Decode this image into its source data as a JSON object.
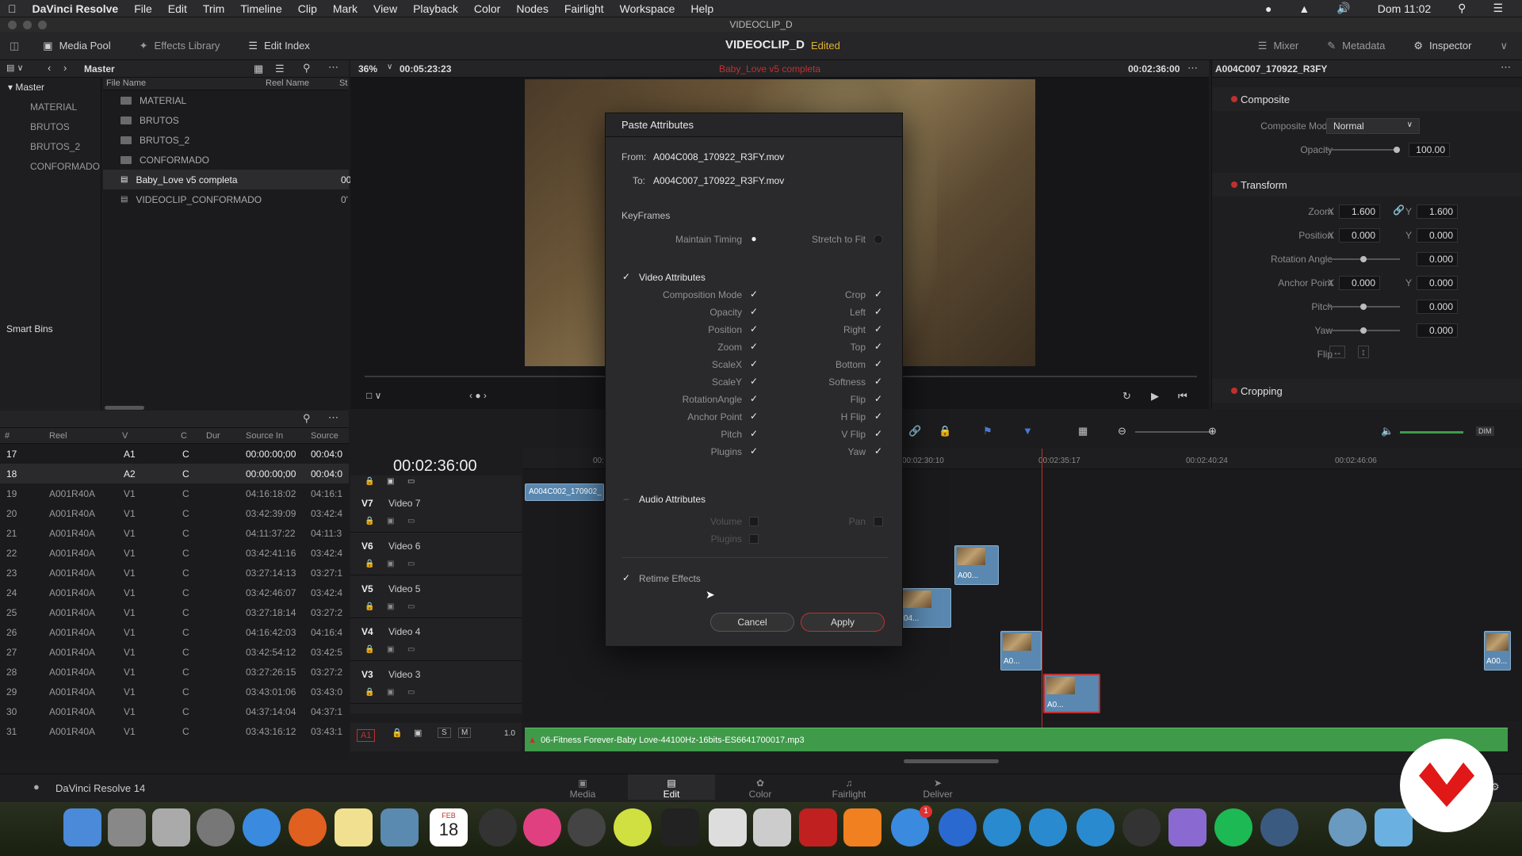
{
  "menubar": {
    "app_name": "DaVinci Resolve",
    "items": [
      "File",
      "Edit",
      "Trim",
      "Timeline",
      "Clip",
      "Mark",
      "View",
      "Playback",
      "Color",
      "Nodes",
      "Fairlight",
      "Workspace",
      "Help"
    ],
    "clock": "Dom 11:02"
  },
  "window": {
    "title": "VIDEOCLIP_D"
  },
  "toolbar": {
    "media_pool": "Media Pool",
    "effects_library": "Effects Library",
    "edit_index": "Edit Index",
    "project_title": "VIDEOCLIP_D",
    "project_status": "Edited",
    "mixer": "Mixer",
    "metadata": "Metadata",
    "inspector": "Inspector"
  },
  "media_pool": {
    "bin_header": "Master",
    "tree_master": "Master",
    "bins": [
      "MATERIAL",
      "BRUTOS",
      "BRUTOS_2",
      "CONFORMADO"
    ],
    "smart_bins": "Smart Bins",
    "columns": {
      "file_name": "File Name",
      "reel_name": "Reel Name",
      "st": "St"
    },
    "files": [
      {
        "name": "MATERIAL",
        "extra": ""
      },
      {
        "name": "BRUTOS",
        "extra": ""
      },
      {
        "name": "BRUTOS_2",
        "extra": ""
      },
      {
        "name": "CONFORMADO",
        "extra": ""
      },
      {
        "name": "Baby_Love v5 completa",
        "extra": "00"
      },
      {
        "name": "VIDEOCLIP_CONFORMADO",
        "extra": "0'"
      }
    ]
  },
  "viewer": {
    "zoom": "36%",
    "source_tc": "00:05:23:23",
    "timeline_name": "Baby_Love v5 completa",
    "record_tc": "00:02:36:00"
  },
  "inspector": {
    "clip_name": "A004C007_170922_R3FY",
    "composite": "Composite",
    "composite_mode_label": "Composite Mode",
    "composite_mode_value": "Normal",
    "opacity_label": "Opacity",
    "opacity_value": "100.00",
    "opacity_level": 1.0,
    "transform": "Transform",
    "zoom_label": "Zoom",
    "zoom_x": "1.600",
    "zoom_y": "1.600",
    "position_label": "Position",
    "position_x": "0.000",
    "position_y": "0.000",
    "rotation_label": "Rotation Angle",
    "rotation_value": "0.000",
    "anchor_label": "Anchor Point",
    "anchor_x": "0.000",
    "anchor_y": "0.000",
    "pitch_label": "Pitch",
    "pitch_value": "0.000",
    "yaw_label": "Yaw",
    "yaw_value": "0.000",
    "flip_label": "Flip",
    "cropping": "Cropping",
    "x": "X",
    "y": "Y"
  },
  "edit_index": {
    "columns": [
      "#",
      "Reel",
      "V",
      "C",
      "Dur",
      "Source In",
      "Source"
    ],
    "rows": [
      {
        "n": "17",
        "reel": "",
        "v": "A1",
        "c": "C",
        "src_in": "00:00:00;00",
        "src": "00:04:0"
      },
      {
        "n": "18",
        "reel": "",
        "v": "A2",
        "c": "C",
        "src_in": "00:00:00;00",
        "src": "00:04:0"
      },
      {
        "n": "19",
        "reel": "A001R40A",
        "v": "V1",
        "c": "C",
        "src_in": "04:16:18:02",
        "src": "04:16:1"
      },
      {
        "n": "20",
        "reel": "A001R40A",
        "v": "V1",
        "c": "C",
        "src_in": "03:42:39:09",
        "src": "03:42:4"
      },
      {
        "n": "21",
        "reel": "A001R40A",
        "v": "V1",
        "c": "C",
        "src_in": "04:11:37:22",
        "src": "04:11:3"
      },
      {
        "n": "22",
        "reel": "A001R40A",
        "v": "V1",
        "c": "C",
        "src_in": "03:42:41:16",
        "src": "03:42:4"
      },
      {
        "n": "23",
        "reel": "A001R40A",
        "v": "V1",
        "c": "C",
        "src_in": "03:27:14:13",
        "src": "03:27:1"
      },
      {
        "n": "24",
        "reel": "A001R40A",
        "v": "V1",
        "c": "C",
        "src_in": "03:42:46:07",
        "src": "03:42:4"
      },
      {
        "n": "25",
        "reel": "A001R40A",
        "v": "V1",
        "c": "C",
        "src_in": "03:27:18:14",
        "src": "03:27:2"
      },
      {
        "n": "26",
        "reel": "A001R40A",
        "v": "V1",
        "c": "C",
        "src_in": "04:16:42:03",
        "src": "04:16:4"
      },
      {
        "n": "27",
        "reel": "A001R40A",
        "v": "V1",
        "c": "C",
        "src_in": "03:42:54:12",
        "src": "03:42:5"
      },
      {
        "n": "28",
        "reel": "A001R40A",
        "v": "V1",
        "c": "C",
        "src_in": "03:27:26:15",
        "src": "03:27:2"
      },
      {
        "n": "29",
        "reel": "A001R40A",
        "v": "V1",
        "c": "C",
        "src_in": "03:43:01:06",
        "src": "03:43:0"
      },
      {
        "n": "30",
        "reel": "A001R40A",
        "v": "V1",
        "c": "C",
        "src_in": "04:37:14:04",
        "src": "04:37:1"
      },
      {
        "n": "31",
        "reel": "A001R40A",
        "v": "V1",
        "c": "C",
        "src_in": "03:43:16:12",
        "src": "03:43:1"
      }
    ]
  },
  "timeline": {
    "timecode": "00:02:36:00",
    "ruler": [
      "00:",
      "00:02:30:10",
      "00:02:35:17",
      "00:02:40:24",
      "00:02:46:06"
    ],
    "tracks": [
      {
        "id": "V7",
        "name": "Video 7"
      },
      {
        "id": "V6",
        "name": "Video 6"
      },
      {
        "id": "V5",
        "name": "Video 5"
      },
      {
        "id": "V4",
        "name": "Video 4"
      },
      {
        "id": "V3",
        "name": "Video 3"
      }
    ],
    "audio_track": "A1",
    "audio_s": "S",
    "audio_m": "M",
    "audio_level": "1.0",
    "audio_clip": "06-Fitness Forever-Baby Love-44100Hz-16bits-ES6641700017.mp3",
    "clip_top": "A004C002_170902_",
    "clip_a00": "A00...",
    "clip_a0": "A0...",
    "clip_04": "04..."
  },
  "dialog": {
    "title": "Paste Attributes",
    "from_label": "From:",
    "from_value": "A004C008_170922_R3FY.mov",
    "to_label": "To:",
    "to_value": "A004C007_170922_R3FY.mov",
    "keyframes": "KeyFrames",
    "maintain_timing": "Maintain Timing",
    "stretch_to_fit": "Stretch to Fit",
    "video_attributes": "Video Attributes",
    "video_left": [
      "Composition Mode",
      "Opacity",
      "Position",
      "Zoom",
      "ScaleX",
      "ScaleY",
      "RotationAngle",
      "Anchor Point",
      "Pitch",
      "Plugins"
    ],
    "video_right": [
      "Crop",
      "Left",
      "Right",
      "Top",
      "Bottom",
      "Softness",
      "Flip",
      "H Flip",
      "V Flip",
      "Yaw"
    ],
    "audio_attributes": "Audio Attributes",
    "volume": "Volume",
    "pan": "Pan",
    "plugins": "Plugins",
    "retime_effects": "Retime Effects",
    "cancel": "Cancel",
    "apply": "Apply"
  },
  "pages": [
    "Media",
    "Edit",
    "Color",
    "Fairlight",
    "Deliver"
  ],
  "active_page": "Edit",
  "status": {
    "app_version": "DaVinci Resolve 14"
  },
  "dock": {
    "calendar_month": "FEB",
    "calendar_day": "18",
    "appstore_badge": "1"
  },
  "colors": {
    "accent": "#c03030",
    "edited": "#e0b030",
    "audio": "#3f9a4a",
    "clip": "#5a88b0"
  }
}
